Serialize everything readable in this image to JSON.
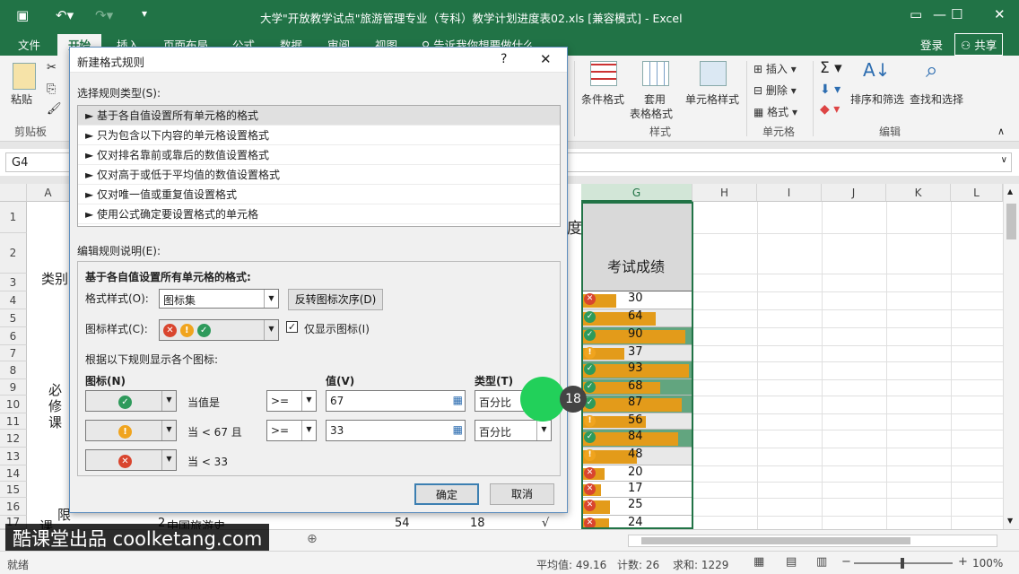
{
  "window": {
    "title": "大学\"开放教学试点\"旅游管理专业（专科）教学计划进度表02.xls [兼容模式] - Excel"
  },
  "ribbon_tabs": [
    "文件",
    "开始",
    "插入",
    "页面布局",
    "公式",
    "数据",
    "审阅",
    "视图",
    "♀ 告诉我你想要做什么"
  ],
  "account": {
    "login": "登录",
    "share": "共享"
  },
  "ribbon": {
    "paste": "粘贴",
    "clipboard": "剪贴板",
    "cond_format": "条件格式",
    "table_format_1": "套用",
    "table_format_2": "表格格式",
    "cell_style": "单元格样式",
    "styles_group": "样式",
    "insert": "插入",
    "delete": "删除",
    "format": "格式",
    "cells_group": "单元格",
    "sort_filter": "排序和筛选",
    "find_select": "查找和选择",
    "editing_group": "编辑"
  },
  "namebox": "G4",
  "columns": [
    "A",
    "G",
    "H",
    "I",
    "J",
    "K",
    "L"
  ],
  "rows": [
    "1",
    "2",
    "3",
    "4",
    "5",
    "6",
    "7",
    "8",
    "9",
    "10",
    "11",
    "12",
    "13",
    "14",
    "15",
    "16",
    "17"
  ],
  "sheet_text": {
    "title_fragment": "度表",
    "category": "类别",
    "bixiu_1": "必",
    "bixiu_2": "修",
    "bixiu_3": "课",
    "ke": "课",
    "xian": "限",
    "row17_b": "2",
    "row17_c": "中国旅游史",
    "row17_d": "54",
    "row17_e": "18",
    "row17_f": "√",
    "g_header": "考试成绩"
  },
  "scores": [
    30,
    64,
    90,
    37,
    93,
    68,
    87,
    56,
    84,
    48,
    20,
    17,
    25,
    24
  ],
  "dialog": {
    "title": "新建格式规则",
    "help": "?",
    "close": "✕",
    "select_type_label": "选择规则类型(S):",
    "rule_types": [
      "► 基于各自值设置所有单元格的格式",
      "► 只为包含以下内容的单元格设置格式",
      "► 仅对排名靠前或靠后的数值设置格式",
      "► 仅对高于或低于平均值的数值设置格式",
      "► 仅对唯一值或重复值设置格式",
      "► 使用公式确定要设置格式的单元格"
    ],
    "edit_label": "编辑规则说明(E):",
    "section_title": "基于各自值设置所有单元格的格式:",
    "format_style_label": "格式样式(O):",
    "format_style_value": "图标集",
    "reverse_btn": "反转图标次序(D)",
    "icon_style_label": "图标样式(C):",
    "show_icon_only": "仅显示图标(I)",
    "rules_caption": "根据以下规则显示各个图标:",
    "col_icon": "图标(N)",
    "col_value": "值(V)",
    "col_type": "类型(T)",
    "row1_text": "当值是",
    "row1_op": ">=",
    "row1_value": "67",
    "row1_type": "百分比",
    "row2_text": "当 < 67 且",
    "row2_op": ">=",
    "row2_value": "33",
    "row2_type": "百分比",
    "row3_text": "当 < 33",
    "ok": "确定",
    "cancel": "取消"
  },
  "step_badge": "18",
  "watermark": "酷课堂出品 coolketang.com",
  "status": {
    "ready": "就绪",
    "average": "平均值: 49.16",
    "count": "计数: 26",
    "sum": "求和: 1229",
    "zoom": "100%"
  },
  "colors": {
    "excel_green": "#217346",
    "bar": "#e39b1a",
    "check": "#2e9a5b",
    "warn": "#f0a41e",
    "cross": "#d9452e",
    "highlight": "#22d05a"
  }
}
